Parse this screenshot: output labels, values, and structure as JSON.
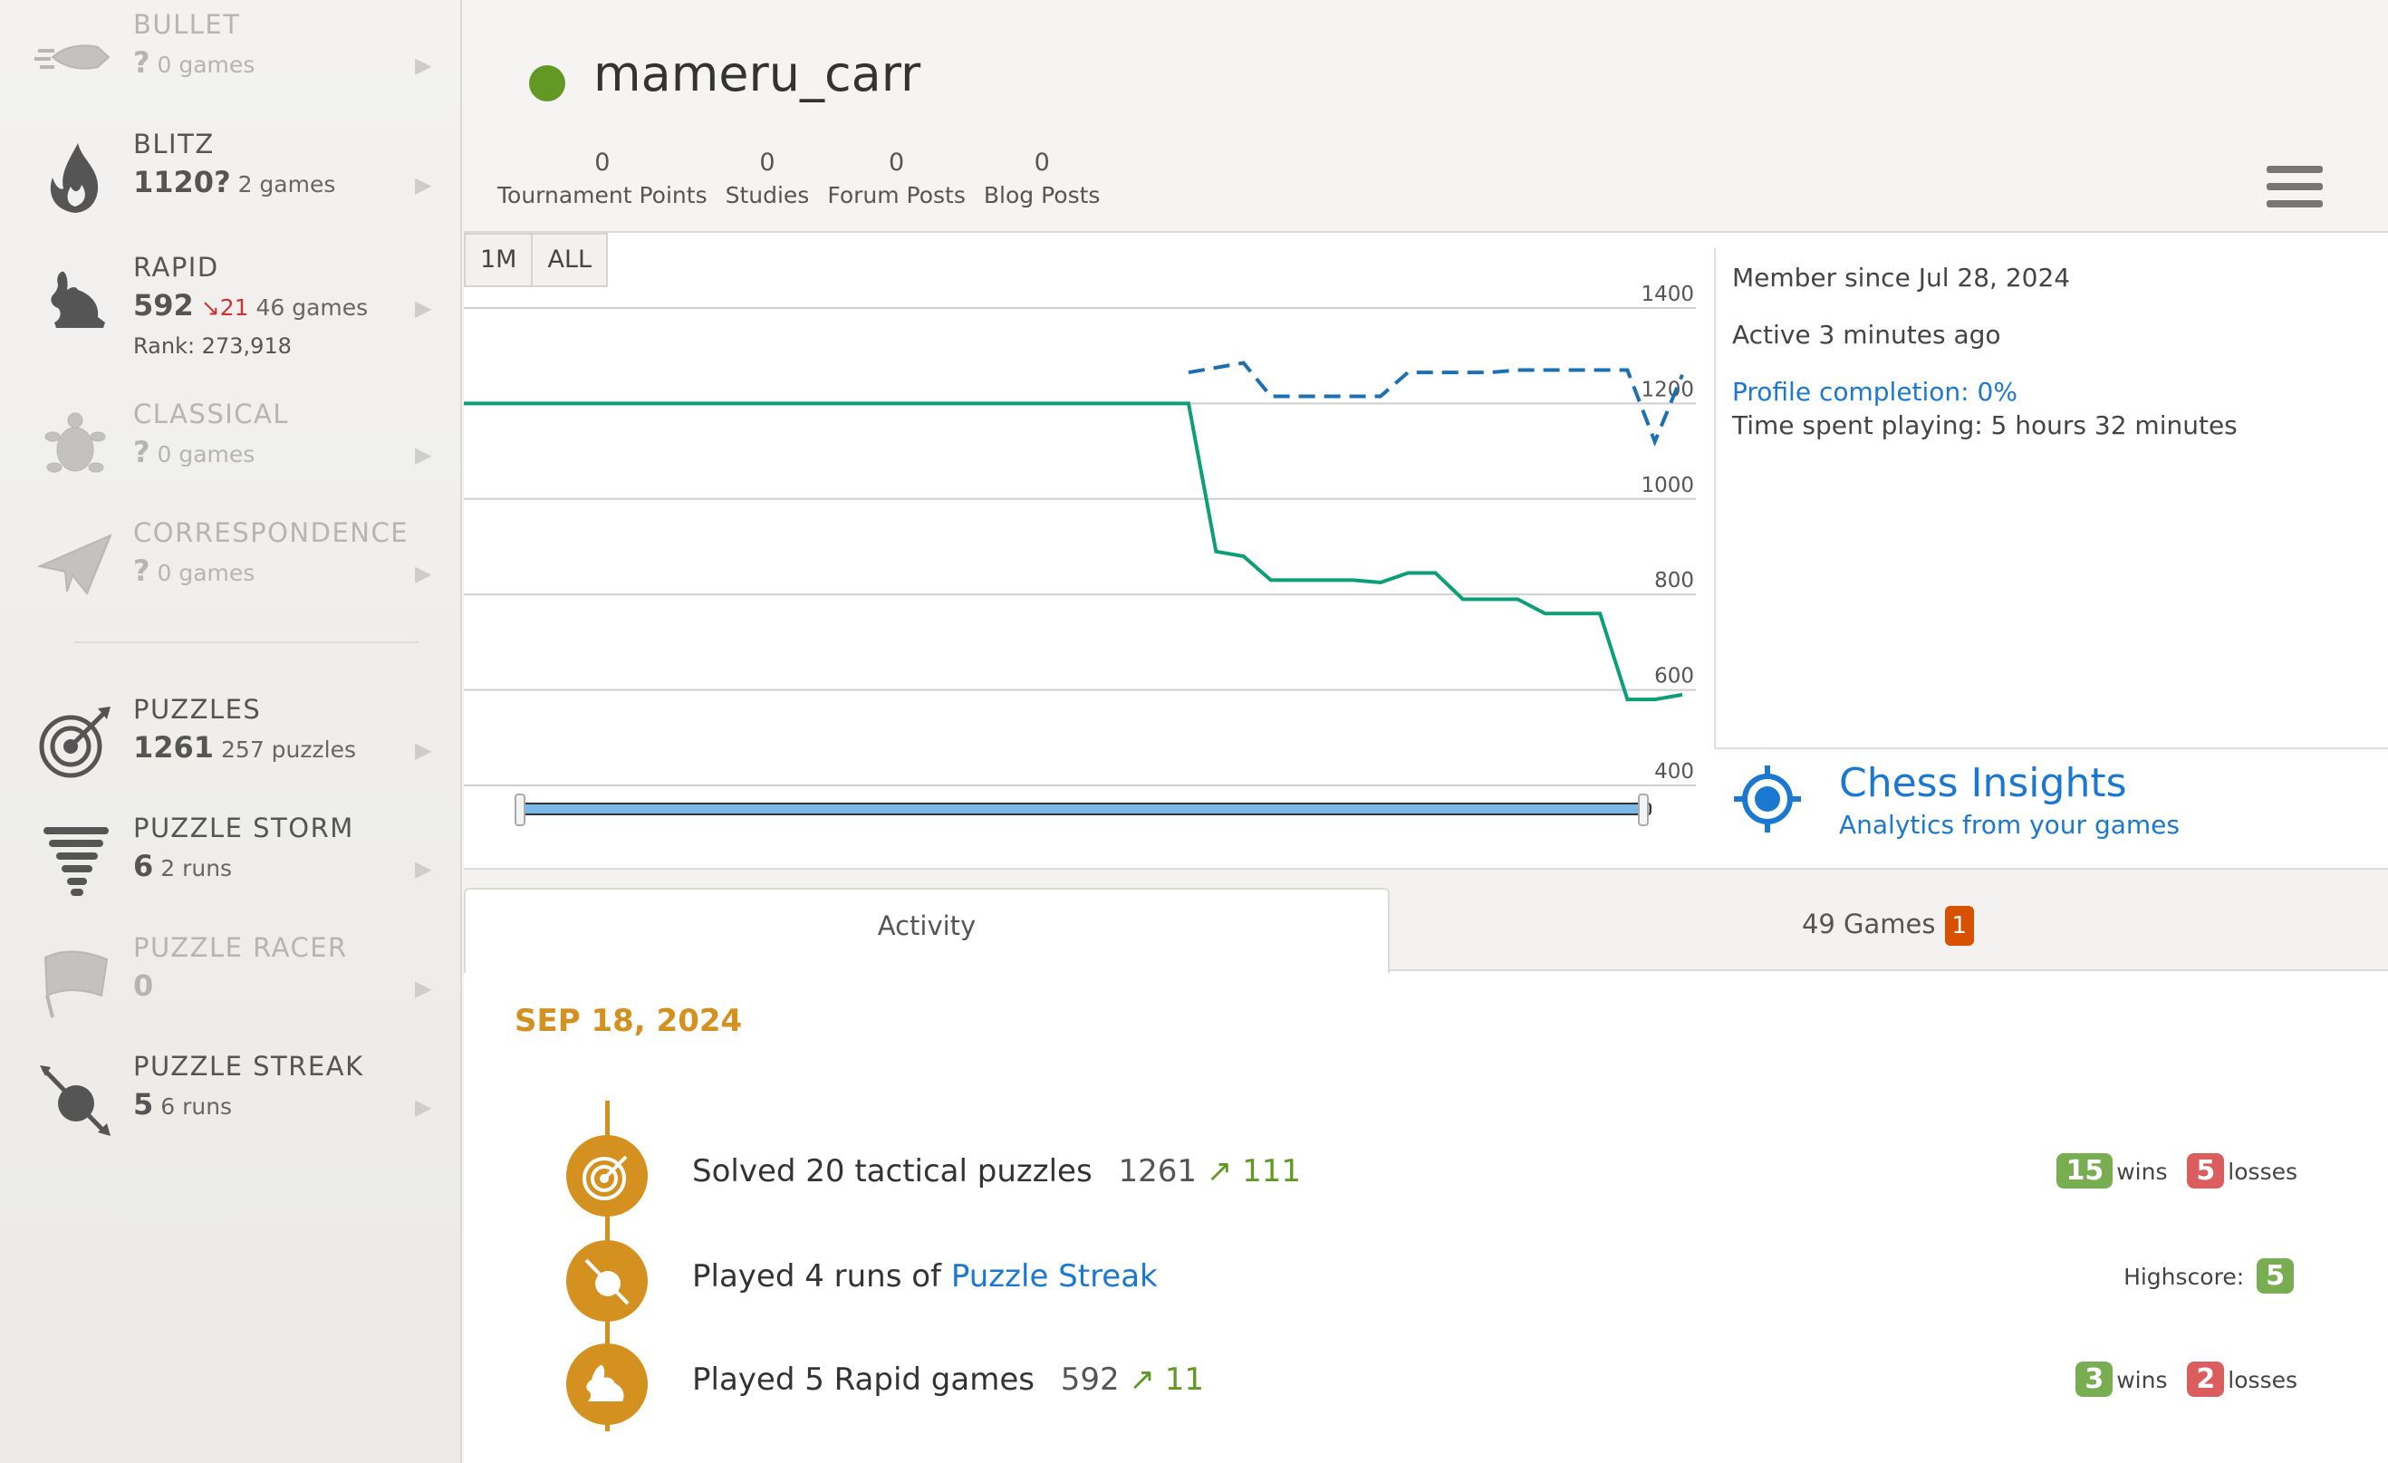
{
  "sidebar": {
    "perfs": [
      {
        "key": "bullet",
        "name": "BULLET",
        "rating": "?",
        "count": "0 games",
        "dim": true
      },
      {
        "key": "blitz",
        "name": "BLITZ",
        "rating": "1120?",
        "count": "2 games",
        "dim": false
      },
      {
        "key": "rapid",
        "name": "RAPID",
        "rating": "592",
        "diff": "21",
        "count": "46 games",
        "rank": "Rank: 273,918",
        "dim": false
      },
      {
        "key": "classical",
        "name": "CLASSICAL",
        "rating": "?",
        "count": "0 games",
        "dim": true
      },
      {
        "key": "correspondence",
        "name": "CORRESPONDENCE",
        "rating": "?",
        "count": "0 games",
        "dim": true
      },
      {
        "key": "puzzles",
        "name": "PUZZLES",
        "rating": "1261",
        "count": "257 puzzles",
        "dim": false
      },
      {
        "key": "storm",
        "name": "PUZZLE STORM",
        "rating": "6",
        "count": "2 runs",
        "dim": false
      },
      {
        "key": "racer",
        "name": "PUZZLE RACER",
        "rating": "0",
        "count": "",
        "dim": true
      },
      {
        "key": "streak",
        "name": "PUZZLE STREAK",
        "rating": "5",
        "count": "6 runs",
        "dim": false
      }
    ]
  },
  "header": {
    "username": "mameru_carr",
    "stats": [
      {
        "n": "0",
        "label": "Tournament Points"
      },
      {
        "n": "0",
        "label": "Studies"
      },
      {
        "n": "0",
        "label": "Forum Posts"
      },
      {
        "n": "0",
        "label": "Blog Posts"
      }
    ]
  },
  "chart": {
    "range_buttons": [
      "1M",
      "ALL"
    ],
    "y_ticks": [
      "1400",
      "1200",
      "1000",
      "800",
      "600",
      "400"
    ]
  },
  "chart_data": {
    "type": "line",
    "ylim": [
      400,
      1400
    ],
    "y_ticks": [
      1400,
      1200,
      1000,
      800,
      600,
      400
    ],
    "grid": true,
    "series": [
      {
        "style": "solid",
        "color": "#0c9e76",
        "values": [
          1200,
          1200,
          1200,
          1200,
          1200,
          1200,
          1200,
          1200,
          1200,
          890,
          880,
          830,
          830,
          830,
          830,
          825,
          845,
          845,
          790,
          790,
          790,
          760,
          760,
          760,
          580,
          580,
          590
        ]
      },
      {
        "style": "dashed",
        "color": "#1b6fb3",
        "values": [
          null,
          null,
          null,
          null,
          null,
          null,
          null,
          null,
          1265,
          1275,
          1285,
          1215,
          1215,
          1215,
          1215,
          1215,
          1265,
          1265,
          1265,
          1265,
          1270,
          1270,
          1270,
          1270,
          1270,
          1120,
          1260
        ]
      }
    ]
  },
  "info": {
    "member_since": "Member since Jul 28, 2024",
    "active": "Active 3 minutes ago",
    "profile_completion": "Profile completion: 0%",
    "time_spent": "Time spent playing: 5 hours 32 minutes"
  },
  "insights": {
    "title": "Chess Insights",
    "subtitle": "Analytics from your games"
  },
  "tabs": {
    "activity": "Activity",
    "games": "49 Games",
    "games_badge": "1"
  },
  "activity": {
    "date": "SEP 18, 2024",
    "entries": [
      {
        "text": "Solved 20 tactical puzzles",
        "rating": "1261",
        "diff": "111",
        "wins": "15",
        "wins_label": "wins",
        "losses": "5",
        "losses_label": "losses"
      },
      {
        "text": "Played 4 runs of",
        "link": "Puzzle Streak",
        "highscore_label": "Highscore:",
        "highscore": "5"
      },
      {
        "text": "Played 5 Rapid games",
        "rating": "592",
        "diff": "11",
        "wins": "3",
        "wins_label": "wins",
        "losses": "2",
        "losses_label": "losses"
      }
    ]
  },
  "colors": {
    "accent": "#d59120",
    "link": "#1b78d0",
    "online": "#629924",
    "win": "#79ad51",
    "loss": "#dc5d5d"
  }
}
